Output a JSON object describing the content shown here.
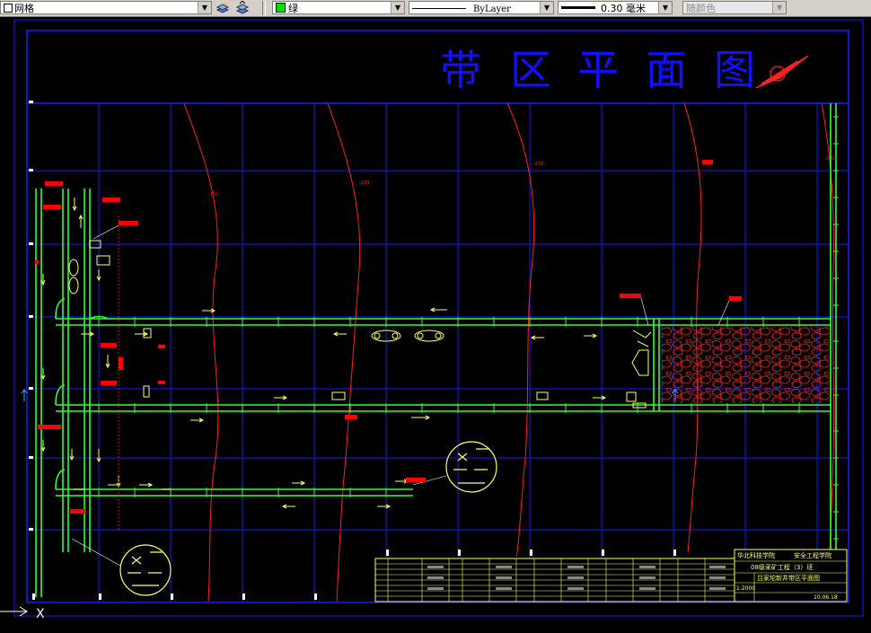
{
  "toolbar": {
    "layer_name": "网格",
    "color_name": "绿",
    "linetype_name": "ByLayer",
    "lineweight_value": "0.30 毫米",
    "plotstyle_name": "随颜色"
  },
  "drawing": {
    "title": "带区平面图",
    "title_chars": [
      "带",
      "区",
      "平",
      "面",
      "图"
    ],
    "contour_labels": [
      "-150",
      "-200",
      "-250",
      "-300"
    ],
    "title_block": {
      "school": "华北科技学院",
      "department": "安全工程学院",
      "class_name": "08级采矿工程（3）班",
      "drawing_name": "吕家坨新井带区平面图",
      "scale": "1:2000",
      "date": "10.06.18"
    },
    "ucs_x_label": "X"
  },
  "colors": {
    "background": "#000000",
    "grid": "#1a1aff",
    "roadway": "#33ff33",
    "contour": "#ff2020",
    "label": "#ff0000",
    "equipment": "#ffff66",
    "goaf": "#ff2020",
    "title": "#1010ff"
  }
}
